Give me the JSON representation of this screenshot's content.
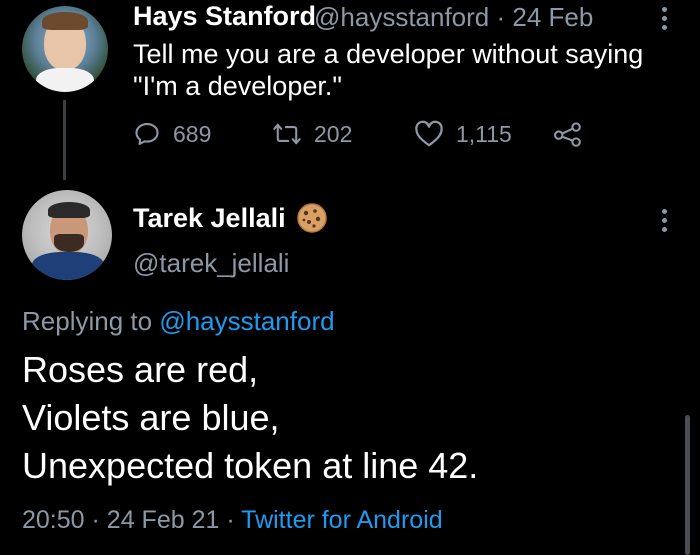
{
  "parent_tweet": {
    "author_name": "Hays Stanford",
    "handle": "@haysstanford",
    "separator": "·",
    "date": "24 Feb",
    "text": "Tell me you are a developer without saying \"I'm a developer.\"",
    "replies": "689",
    "retweets": "202",
    "likes": "1,115"
  },
  "reply_tweet": {
    "author_name": "Tarek Jellali",
    "name_emoji": "🍪",
    "handle": "@tarek_jellali",
    "replying_prefix": "Replying to",
    "replying_to": "@haysstanford",
    "lines": [
      "Roses are red,",
      "Violets are blue,",
      "Unexpected token at line 42."
    ],
    "time": "20:50",
    "separator1": "·",
    "date": "24 Feb 21",
    "separator2": "·",
    "source": "Twitter for Android"
  },
  "colors": {
    "background": "#000000",
    "muted": "#8b98a5",
    "link": "#1d9bf0"
  },
  "icons": [
    "reply-icon",
    "retweet-icon",
    "like-icon",
    "share-icon",
    "more-options-icon",
    "cookie-emoji-icon"
  ]
}
